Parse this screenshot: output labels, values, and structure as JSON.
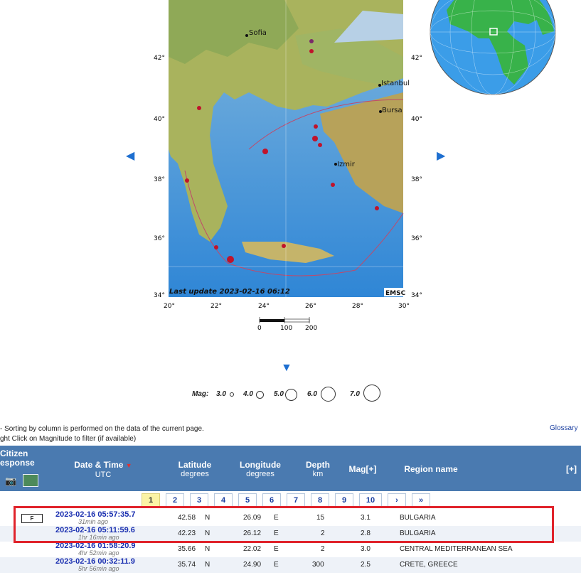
{
  "map": {
    "lat_ticks": [
      "42°",
      "40°",
      "38°",
      "36°",
      "34°"
    ],
    "lon_ticks": [
      "20°",
      "22°",
      "24°",
      "26°",
      "28°",
      "30°"
    ],
    "cities": [
      "Sofia",
      "Istanbul",
      "Bursa",
      "Izmir"
    ],
    "last_update": "Last update 2023-02-16 06:12",
    "emsc_logo": "EMSC",
    "scale_labels": [
      "0",
      "100",
      "200"
    ]
  },
  "mag_legend": {
    "label": "Mag:",
    "values": [
      "3.0",
      "4.0",
      "5.0",
      "6.0",
      "7.0"
    ]
  },
  "notes": {
    "line1": "- Sorting by column is performed on the data of the current page.",
    "line2": "ght Click on Magnitude to filter (if available)",
    "glossary": "Glossary"
  },
  "table_header": {
    "citizen": "Citizen",
    "response": "esponse",
    "date_time": "Date & Time",
    "utc": "UTC",
    "latitude": "Latitude",
    "lat_unit": "degrees",
    "longitude": "Longitude",
    "lon_unit": "degrees",
    "depth": "Depth",
    "depth_unit": "km",
    "mag": "Mag[+]",
    "region": "Region name",
    "expand": "[+]"
  },
  "pager": [
    "1",
    "2",
    "3",
    "4",
    "5",
    "6",
    "7",
    "8",
    "9",
    "10",
    "›",
    "»"
  ],
  "rows": [
    {
      "flag": "F",
      "datetime": "2023-02-16   05:57:35.7",
      "ago": "31min ago",
      "lat": "42.58",
      "ns": "N",
      "lon": "26.09",
      "ew": "E",
      "depth": "15",
      "mag": "3.1",
      "region": "BULGARIA"
    },
    {
      "flag": "",
      "datetime": "2023-02-16   05:11:59.6",
      "ago": "1hr 16min ago",
      "lat": "42.23",
      "ns": "N",
      "lon": "26.12",
      "ew": "E",
      "depth": "2",
      "mag": "2.8",
      "region": "BULGARIA"
    },
    {
      "flag": "",
      "datetime": "2023-02-16   01:58:20.9",
      "ago": "4hr 52min ago",
      "lat": "35.66",
      "ns": "N",
      "lon": "22.02",
      "ew": "E",
      "depth": "2",
      "mag": "3.0",
      "region": "CENTRAL MEDITERRANEAN SEA"
    },
    {
      "flag": "",
      "datetime": "2023-02-16   00:32:11.9",
      "ago": "5hr 56min ago",
      "lat": "35.74",
      "ns": "N",
      "lon": "24.90",
      "ew": "E",
      "depth": "300",
      "mag": "2.5",
      "region": "CRETE, GREECE"
    }
  ],
  "colors": {
    "header_bg": "#4a7ab0",
    "highlight": "#e0232b",
    "link": "#1a2fb0"
  }
}
